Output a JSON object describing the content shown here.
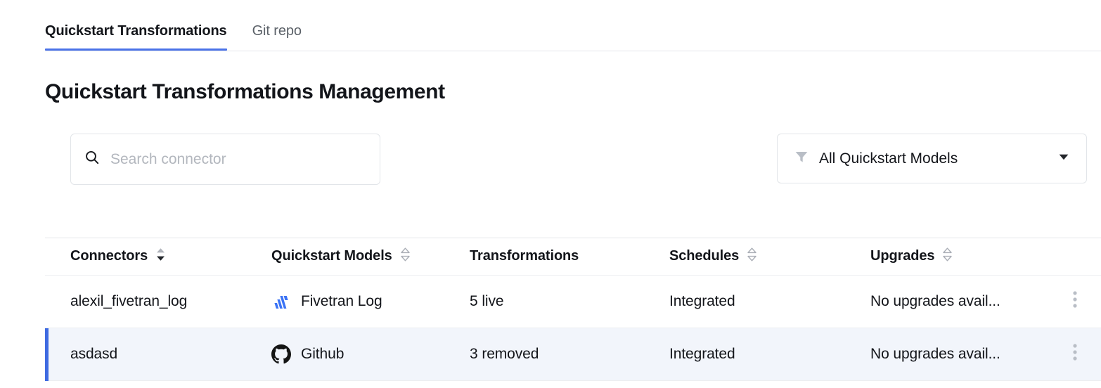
{
  "tabs": [
    {
      "label": "Quickstart Transformations",
      "active": true
    },
    {
      "label": "Git repo",
      "active": false
    }
  ],
  "page": {
    "title": "Quickstart Transformations Management"
  },
  "search": {
    "placeholder": "Search connector",
    "value": "",
    "icon": "search-icon"
  },
  "filter": {
    "label": "All Quickstart Models",
    "icon": "funnel-icon",
    "caret": "caret-down-icon"
  },
  "table": {
    "columns": [
      {
        "label": "Connectors",
        "sortable": true,
        "sort": "desc"
      },
      {
        "label": "Quickstart Models",
        "sortable": true,
        "sort": "none"
      },
      {
        "label": "Transformations",
        "sortable": false,
        "sort": "none"
      },
      {
        "label": "Schedules",
        "sortable": true,
        "sort": "none"
      },
      {
        "label": "Upgrades",
        "sortable": true,
        "sort": "none"
      }
    ],
    "rows": [
      {
        "connector": "alexil_fivetran_log",
        "model": "Fivetran Log",
        "model_logo": "fivetran-logo",
        "transformations": "5 live",
        "schedules": "Integrated",
        "upgrades": "No upgrades avail...",
        "selected": false,
        "actions_icon": "kebab-menu-icon"
      },
      {
        "connector": "asdasd",
        "model": "Github",
        "model_logo": "github-logo",
        "transformations": "3 removed",
        "schedules": "Integrated",
        "upgrades": "No upgrades avail...",
        "selected": true,
        "actions_icon": "kebab-menu-icon"
      }
    ]
  },
  "colors": {
    "accent": "#4a72e8",
    "selected_row_bg": "#f2f5fb",
    "selected_row_bar": "#3e6ae1",
    "border": "#e2e5e9",
    "text": "#13151a",
    "muted_text": "#5b6168",
    "placeholder": "#b3b7be",
    "fivetran_blue": "#3b73f5",
    "github_black": "#141414",
    "sort_inactive": "#a9adb5",
    "sort_active": "#23262b"
  }
}
